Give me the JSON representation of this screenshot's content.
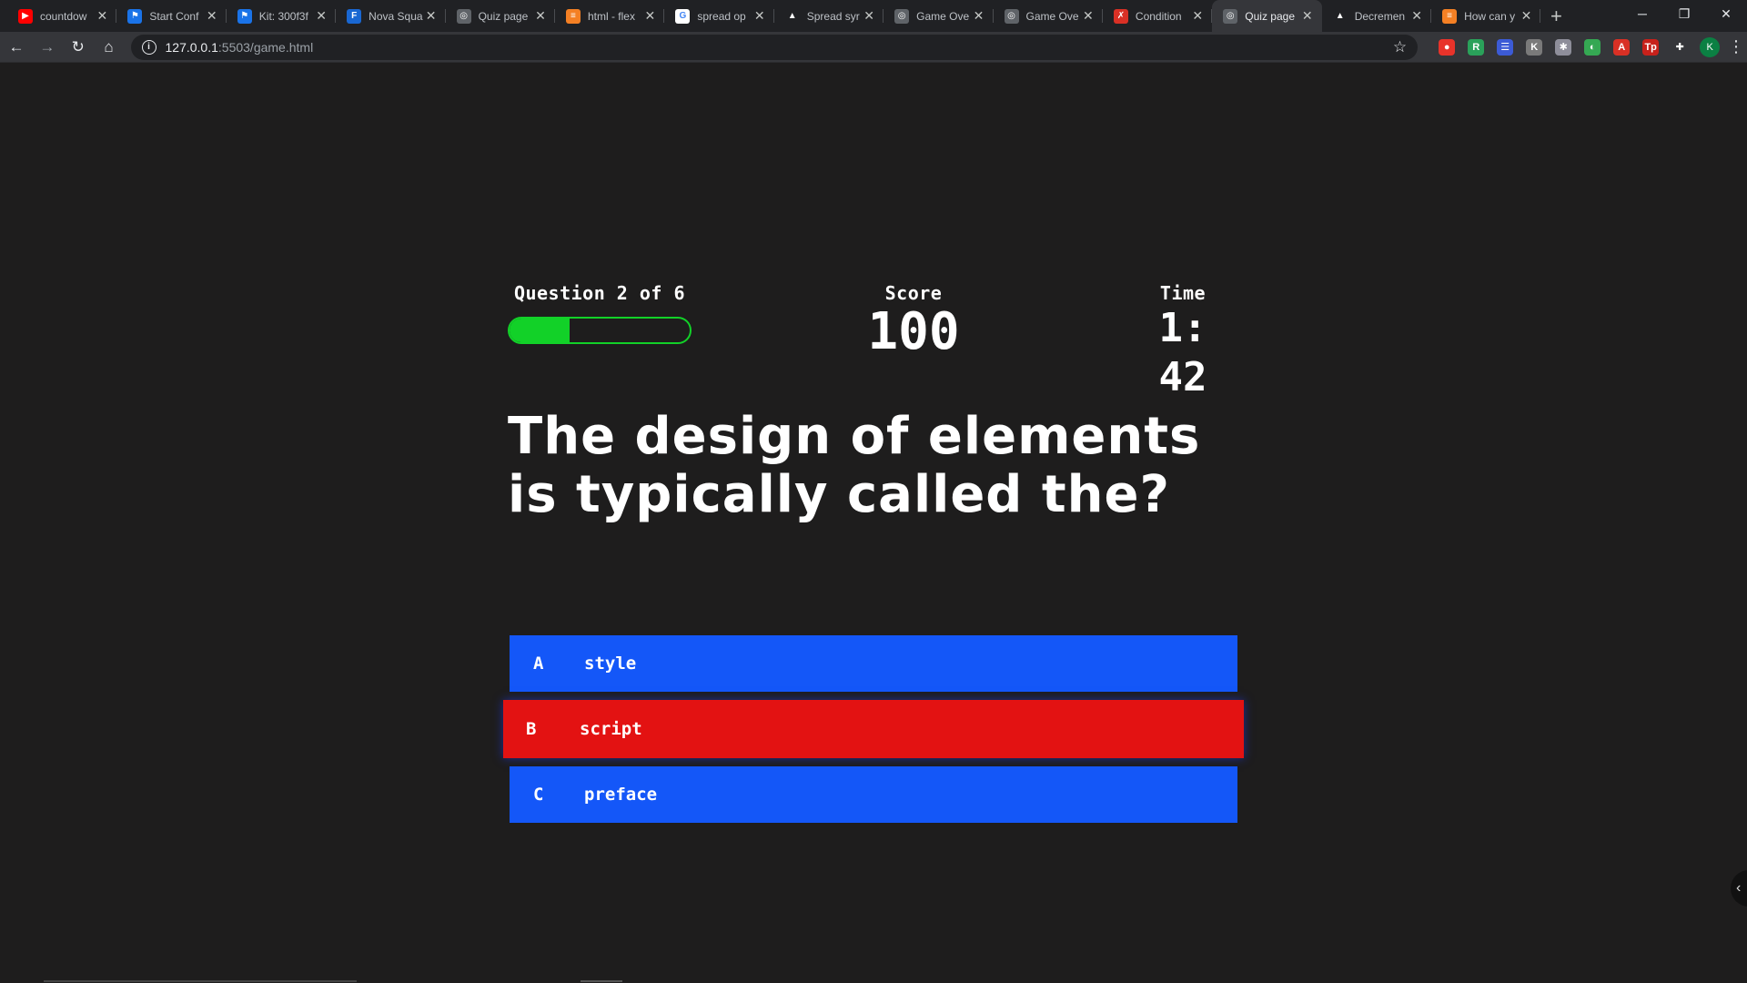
{
  "browser": {
    "tabs": [
      {
        "title": "countdow",
        "favicon": "youtube-icon",
        "color": "#ff0000",
        "glyph": "▶"
      },
      {
        "title": "Start Conf",
        "favicon": "flag-icon",
        "color": "#1a73e8",
        "glyph": "⚑"
      },
      {
        "title": "Kit: 300f3f",
        "favicon": "flag-icon",
        "color": "#1a73e8",
        "glyph": "⚑"
      },
      {
        "title": "Nova Squa",
        "favicon": "f-icon",
        "color": "#1967d2",
        "glyph": "F"
      },
      {
        "title": "Quiz page",
        "favicon": "globe-icon",
        "color": "#5f6368",
        "glyph": "◎"
      },
      {
        "title": "html - flex",
        "favicon": "stackoverflow-icon",
        "color": "#f48024",
        "glyph": "≡"
      },
      {
        "title": "spread op",
        "favicon": "google-icon",
        "color": "#ffffff",
        "glyph": "G"
      },
      {
        "title": "Spread syr",
        "favicon": "graduation-cap-icon",
        "color": "#202124",
        "glyph": "▲"
      },
      {
        "title": "Game Ove",
        "favicon": "globe-icon",
        "color": "#5f6368",
        "glyph": "◎"
      },
      {
        "title": "Game Ove",
        "favicon": "globe-icon",
        "color": "#5f6368",
        "glyph": "◎"
      },
      {
        "title": "Condition",
        "favicon": "w3-icon",
        "color": "#d93025",
        "glyph": "✗"
      },
      {
        "title": "Quiz page",
        "favicon": "globe-icon",
        "color": "#5f6368",
        "glyph": "◎",
        "active": true
      },
      {
        "title": "Decremen",
        "favicon": "graduation-cap-icon",
        "color": "#202124",
        "glyph": "▲"
      },
      {
        "title": "How can y",
        "favicon": "stackoverflow-icon",
        "color": "#f48024",
        "glyph": "≡"
      }
    ],
    "url_host": "127.0.0.1",
    "url_path": ":5503/game.html",
    "profile_initial": "K",
    "extensions": [
      {
        "name": "shield-red-icon",
        "color": "#e8332a",
        "glyph": "●"
      },
      {
        "name": "r-extension-icon",
        "color": "#2aa15a",
        "glyph": "R"
      },
      {
        "name": "grid-extension-icon",
        "color": "#3c5bd6",
        "glyph": "☰"
      },
      {
        "name": "k-extension-icon",
        "color": "#7a7a7a",
        "glyph": "K"
      },
      {
        "name": "puzzle-cross-icon",
        "color": "#8e8e9a",
        "glyph": "✱"
      },
      {
        "name": "green-leaf-icon",
        "color": "#35a853",
        "glyph": "◐"
      },
      {
        "name": "pdf-icon",
        "color": "#d93025",
        "glyph": "A"
      },
      {
        "name": "tp-icon",
        "color": "#c7211b",
        "glyph": "Tp"
      },
      {
        "name": "extensions-puzzle-icon",
        "color": "#35363a",
        "glyph": "✚"
      }
    ]
  },
  "hud": {
    "progress_text": "Question 2 of 6",
    "progress_fraction": 0.333,
    "score_label": "Score",
    "score_value": "100",
    "time_label": "Time",
    "time_value": "1: 42"
  },
  "question": "The design of elements is typically called the?",
  "choices": [
    {
      "prefix": "A",
      "text": "style",
      "state": "default"
    },
    {
      "prefix": "B",
      "text": "script",
      "state": "incorrect"
    },
    {
      "prefix": "C",
      "text": "preface",
      "state": "default"
    }
  ],
  "colors": {
    "background": "#1e1d1d",
    "choice": "#1457f8",
    "incorrect": "#e31212",
    "progress": "#12d128"
  }
}
